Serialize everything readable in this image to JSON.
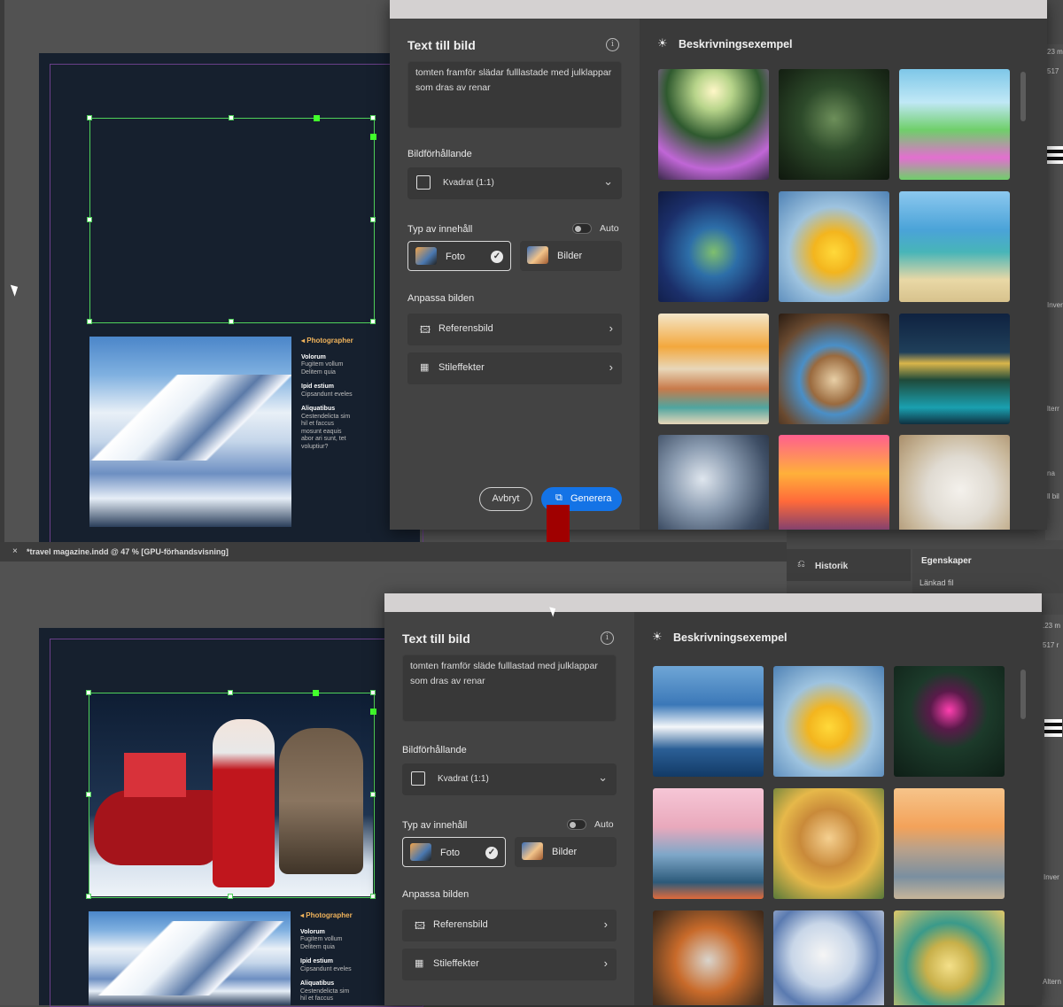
{
  "top": {
    "panel": {
      "title": "Text till bild",
      "prompt": "tomten framför slädar fulllastade med julklappar som dras av renar",
      "aspect_label": "Bildförhållande",
      "aspect_value": "Kvadrat (1:1)",
      "content_label": "Typ av innehåll",
      "auto_label": "Auto",
      "photo_label": "Foto",
      "art_label": "Bilder",
      "adjust_label": "Anpassa bilden",
      "reference_label": "Referensbild",
      "style_label": "Stileffekter",
      "cancel_label": "Avbryt",
      "generate_label": "Generera",
      "examples_title": "Beskrivningsexempel"
    }
  },
  "bottom": {
    "panel": {
      "title": "Text till bild",
      "prompt": "tomten framför släde fulllastad med julklappar som dras av renar",
      "aspect_label": "Bildförhållande",
      "aspect_value": "Kvadrat (1:1)",
      "content_label": "Typ av innehåll",
      "auto_label": "Auto",
      "photo_label": "Foto",
      "art_label": "Bilder",
      "adjust_label": "Anpassa bilden",
      "reference_label": "Referensbild",
      "style_label": "Stileffekter",
      "examples_title": "Beskrivningsexempel"
    }
  },
  "layout_text": {
    "doc_tab": "*travel magazine.indd @ 47 % [GPU-förhandsvisning]",
    "tab_close": "×",
    "history_tab": "Historik",
    "properties_tab": "Egenskaper",
    "linked_file": "Länkad fil",
    "edge_top": [
      "23 m",
      "517"
    ],
    "edge_bottom": [
      ".23 m",
      "517 r"
    ],
    "edge_misc": [
      "Inver",
      "lterr",
      "na",
      "ll bil",
      "Altern"
    ]
  },
  "article": {
    "heading": "Photographer",
    "blocks": [
      {
        "title": "Volorum",
        "lines": [
          "Fugitem vollum",
          "Delitem quia"
        ]
      },
      {
        "title": "Ipid estium",
        "lines": [
          "Cipsandunt eveles"
        ]
      },
      {
        "title": "Aliquatibus",
        "lines": [
          "Cestendelicta sim",
          "hil et faccus",
          "mosunt eaquis",
          "abor ari sunt, tet",
          "voluptiur?"
        ]
      }
    ],
    "heading_b": "Photographer",
    "blocks_b": [
      {
        "title": "Volorum",
        "lines": [
          "Fugitem vollum",
          "Delitem quia"
        ]
      },
      {
        "title": "Ipid estium",
        "lines": [
          "Cipsandunt eveles"
        ]
      },
      {
        "title": "Aliquatibus",
        "lines": [
          "Cestendelicta sim",
          "hil et faccus"
        ]
      }
    ]
  },
  "icons": {
    "info": "info-icon",
    "bulb": "lightbulb-icon",
    "square": "square-aspect-icon",
    "chevron_down": "chevron-down-icon",
    "chevron_right": "chevron-right-icon",
    "check": "checkmark-icon",
    "reference": "image-reference-icon",
    "style": "style-effects-icon",
    "generate": "generate-icon",
    "history": "history-icon",
    "cursor": "mouse-cursor-icon",
    "arrow": "red-down-arrow"
  },
  "colors": {
    "accent": "#1473e6",
    "selection": "#4fd25a",
    "arrow": "#a00000"
  }
}
